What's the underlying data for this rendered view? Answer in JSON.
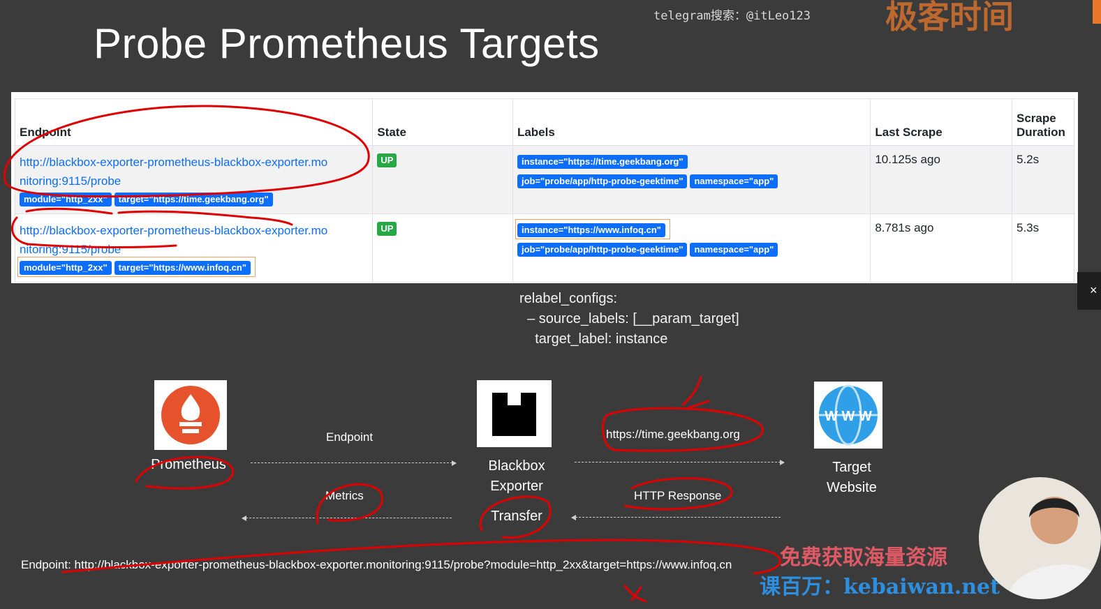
{
  "slide": {
    "title": "Probe Prometheus Targets",
    "watermark_top": "telegram搜索：@itLeo123",
    "brand_text": "极客时间"
  },
  "table": {
    "headers": [
      "Endpoint",
      "State",
      "Labels",
      "Last Scrape",
      "Scrape Duration"
    ],
    "rows": [
      {
        "endpoint_line1": "http://blackbox-exporter-prometheus-blackbox-exporter.mo",
        "endpoint_line2": "nitoring:9115/probe",
        "endpoint_badges": [
          "module=\"http_2xx\"",
          "target=\"https://time.geekbang.org\""
        ],
        "state": "UP",
        "labels": [
          "instance=\"https://time.geekbang.org\"",
          "job=\"probe/app/http-probe-geektime\"",
          "namespace=\"app\""
        ],
        "last_scrape": "10.125s ago",
        "duration": "5.2s"
      },
      {
        "endpoint_line1": "http://blackbox-exporter-prometheus-blackbox-exporter.mo",
        "endpoint_line2": "nitoring:9115/probe",
        "endpoint_badges": [
          "module=\"http_2xx\"",
          "target=\"https://www.infoq.cn\""
        ],
        "state": "UP",
        "labels": [
          "instance=\"https://www.infoq.cn\"",
          "job=\"probe/app/http-probe-geektime\"",
          "namespace=\"app\""
        ],
        "last_scrape": "8.781s ago",
        "duration": "5.3s"
      }
    ]
  },
  "relabel": {
    "line1": "relabel_configs:",
    "line2": "  – source_labels: [__param_target]",
    "line3": "    target_label: instance"
  },
  "diagram": {
    "prometheus_label": "Prometheus",
    "blackbox_label_1": "Blackbox",
    "blackbox_label_2": "Exporter",
    "target_label_1": "Target",
    "target_label_2": "Website",
    "www_text": "W W W",
    "endpoint_arrow": "Endpoint",
    "metrics_arrow": "Metrics",
    "transfer_label": "Transfer",
    "url_arrow": "https://time.geekbang.org",
    "http_response_arrow": "HTTP Response",
    "colors": {
      "prometheus": "#e6522c",
      "www_globe": "#2f9fe8"
    }
  },
  "footer": {
    "endpoint_full": "Endpoint: http://blackbox-exporter-prometheus-blackbox-exporter.monitoring:9115/probe?module=http_2xx&target=https://www.infoq.cn",
    "promo_line1": "免费获取海量资源",
    "promo_line2": "课百万：kebaiwan.net"
  }
}
